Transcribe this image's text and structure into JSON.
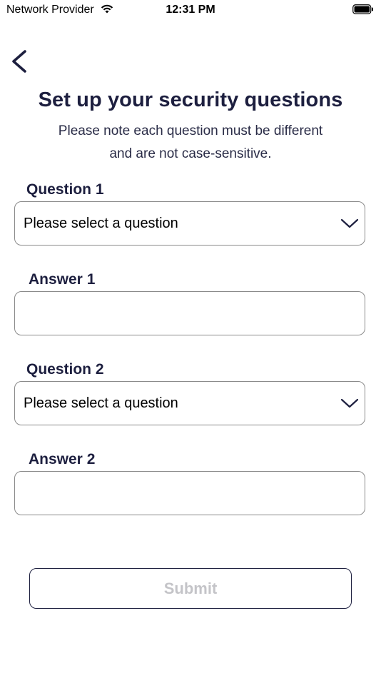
{
  "status_bar": {
    "carrier": "Network Provider",
    "time": "12:31 PM",
    "wifi_icon": "wifi-icon",
    "battery_icon": "battery-icon"
  },
  "nav": {
    "back_icon": "chevron-left-icon"
  },
  "header": {
    "title": "Set up your security questions",
    "subtitle_line1": "Please note each question must be different",
    "subtitle_line2": "and are not case-sensitive."
  },
  "form": {
    "question1": {
      "label": "Question 1",
      "selected": "Please select a question"
    },
    "answer1": {
      "label": "Answer 1",
      "value": ""
    },
    "question2": {
      "label": "Question 2",
      "selected": "Please select a question"
    },
    "answer2": {
      "label": "Answer 2",
      "value": ""
    },
    "submit_label": "Submit"
  },
  "colors": {
    "primary_text": "#1d1f3f",
    "border": "#8a8a8a",
    "disabled_text": "#c4c4c8"
  }
}
